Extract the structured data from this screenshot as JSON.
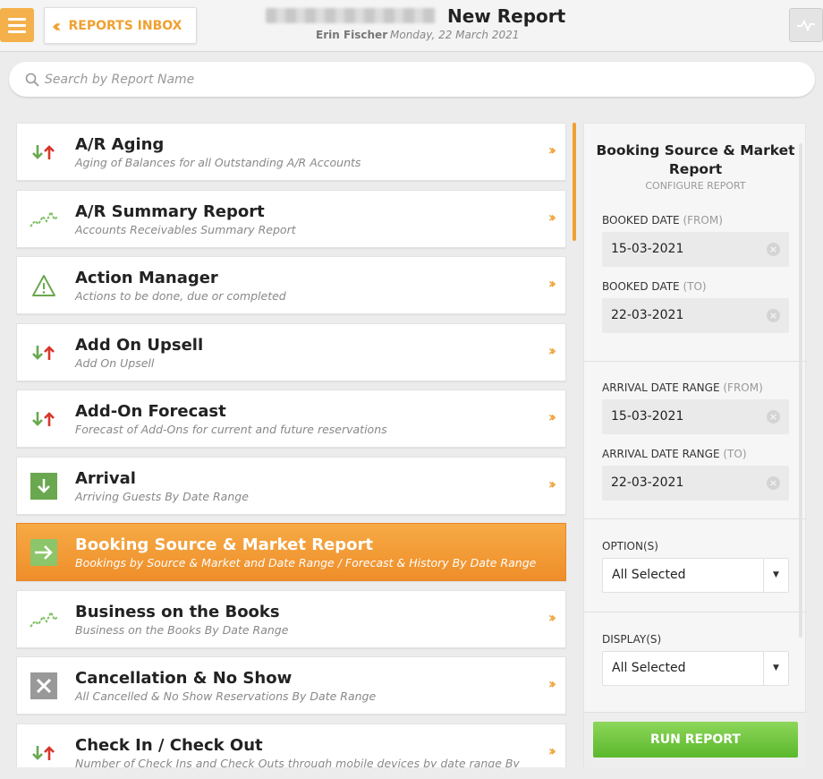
{
  "header": {
    "inbox_label": "REPORTS INBOX",
    "title": "New Report",
    "user_name": "Erin Fischer",
    "date": "Monday, 22 March 2021"
  },
  "search": {
    "placeholder": "Search by Report Name",
    "value": ""
  },
  "reports": [
    {
      "name": "A/R Aging",
      "desc": "Aging of Balances for all Outstanding A/R Accounts",
      "icon": "up-down-arrows-icon"
    },
    {
      "name": "A/R Summary Report",
      "desc": "Accounts Receivables Summary Report",
      "icon": "trend-line-icon"
    },
    {
      "name": "Action Manager",
      "desc": "Actions to be done, due or completed",
      "icon": "warning-triangle-icon"
    },
    {
      "name": "Add On Upsell",
      "desc": "Add On Upsell",
      "icon": "up-down-arrows-icon"
    },
    {
      "name": "Add-On Forecast",
      "desc": "Forecast of Add-Ons for current and future reservations",
      "icon": "up-down-arrows-icon"
    },
    {
      "name": "Arrival",
      "desc": "Arriving Guests By Date Range",
      "icon": "arrival-icon"
    },
    {
      "name": "Booking Source & Market Report",
      "desc": "Bookings by Source & Market and Date Range / Forecast & History By Date Range",
      "icon": "arrow-right-icon",
      "selected": true
    },
    {
      "name": "Business on the Books",
      "desc": "Business on the Books By Date Range",
      "icon": "trend-line-icon"
    },
    {
      "name": "Cancellation & No Show",
      "desc": "All Cancelled & No Show Reservations By Date Range",
      "icon": "cancel-x-icon"
    },
    {
      "name": "Check In / Check Out",
      "desc": "Number of Check Ins and Check Outs through mobile devices by date range By",
      "icon": "up-down-arrows-icon"
    }
  ],
  "config": {
    "title": "Booking Source & Market Report",
    "subtitle": "CONFIGURE REPORT",
    "booked_from_label": "BOOKED DATE",
    "booked_from_suffix": "(FROM)",
    "booked_from_value": "15-03-2021",
    "booked_to_label": "BOOKED DATE",
    "booked_to_suffix": "(TO)",
    "booked_to_value": "22-03-2021",
    "arrival_from_label": "ARRIVAL DATE RANGE",
    "arrival_from_suffix": "(FROM)",
    "arrival_from_value": "15-03-2021",
    "arrival_to_label": "ARRIVAL DATE RANGE",
    "arrival_to_suffix": "(TO)",
    "arrival_to_value": "22-03-2021",
    "options_label": "OPTION(S)",
    "options_value": "All Selected",
    "display_label": "DISPLAY(S)",
    "display_value": "All Selected",
    "run_label": "RUN REPORT"
  },
  "colors": {
    "accent": "#f0a030",
    "run": "#6cc13a",
    "up_arrow": "#d9362b",
    "down_arrow": "#6aa84f"
  }
}
